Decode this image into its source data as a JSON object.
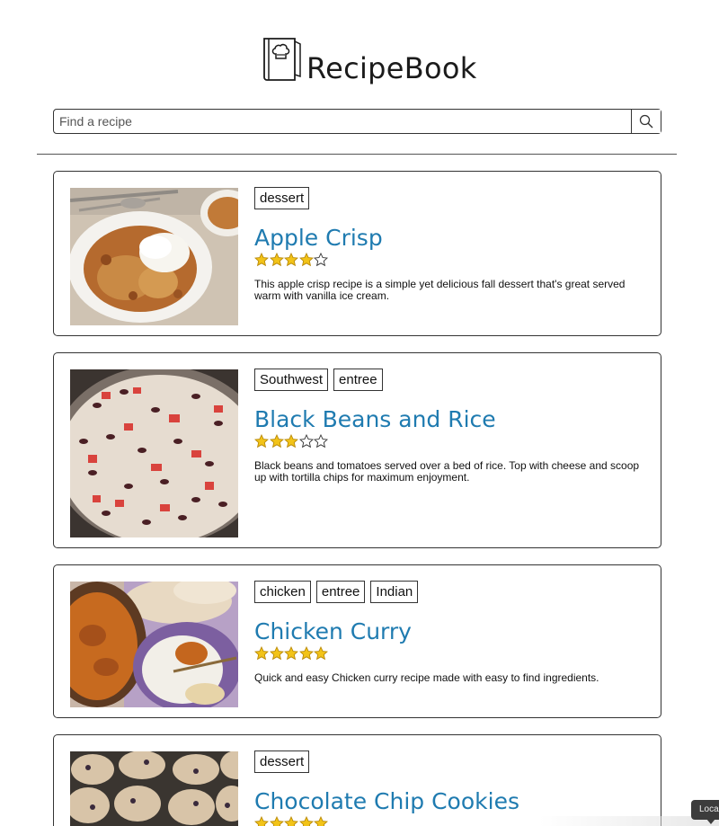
{
  "app": {
    "name": "RecipeBook"
  },
  "search": {
    "placeholder": "Find a recipe",
    "value": ""
  },
  "recipes": [
    {
      "title": "Apple Crisp",
      "tags": [
        "dessert"
      ],
      "rating": 4,
      "max_rating": 5,
      "description": "This apple crisp recipe is a simple yet delicious fall dessert that's great served warm with vanilla ice cream."
    },
    {
      "title": "Black Beans and Rice",
      "tags": [
        "Southwest",
        "entree"
      ],
      "rating": 3,
      "max_rating": 5,
      "description": "Black beans and tomatoes served over a bed of rice. Top with cheese and scoop up with tortilla chips for maximum enjoyment."
    },
    {
      "title": "Chicken Curry",
      "tags": [
        "chicken",
        "entree",
        "Indian"
      ],
      "rating": 5,
      "max_rating": 5,
      "description": "Quick and easy Chicken curry recipe made with easy to find ingredients."
    },
    {
      "title": "Chocolate Chip Cookies",
      "tags": [
        "dessert"
      ],
      "rating": 5,
      "max_rating": 5,
      "description": ""
    }
  ],
  "tooltip": {
    "text": "Loca"
  },
  "colors": {
    "title_link": "#1f7bb0",
    "star_fill": "#f2c318",
    "border": "#333333"
  }
}
